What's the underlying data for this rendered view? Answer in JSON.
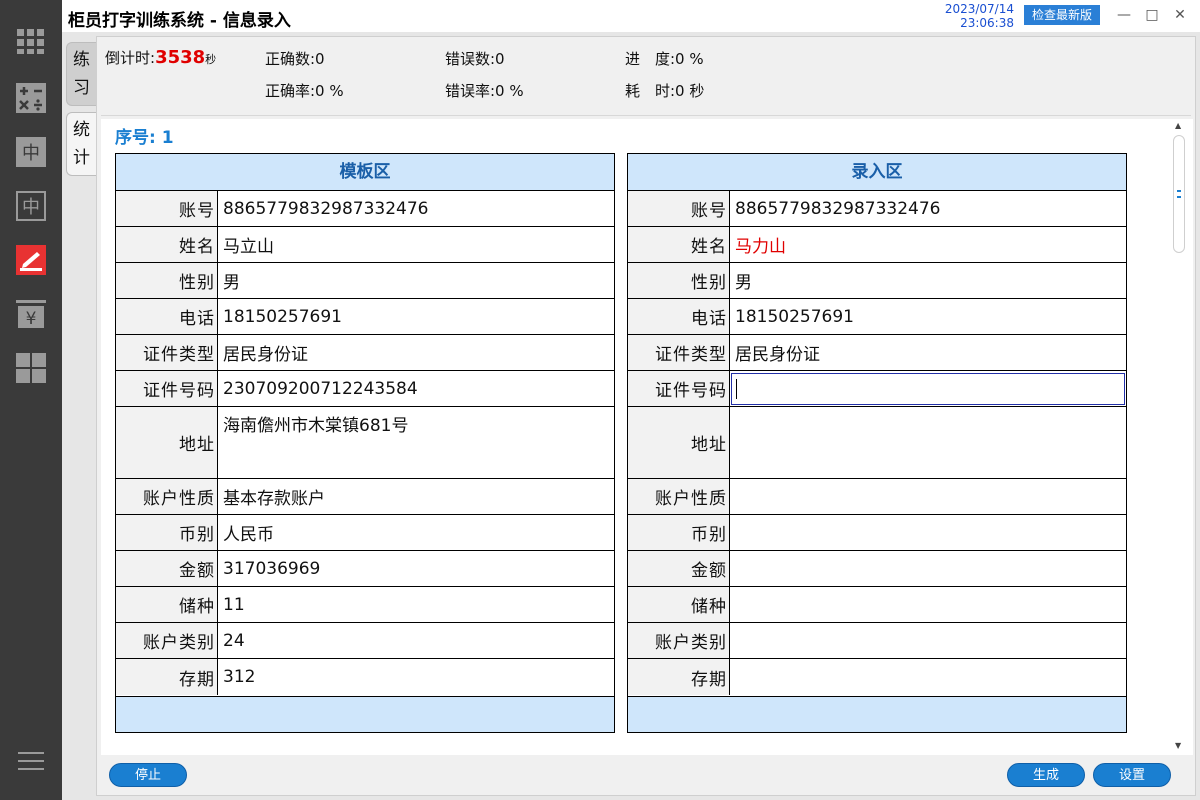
{
  "window": {
    "title": "柜员打字训练系统 - 信息录入",
    "date": "2023/07/14",
    "time": "23:06:38",
    "update_button": "检查最新版",
    "minimize": "—",
    "maximize": "□",
    "close": "✕"
  },
  "tabs": [
    {
      "label": "练习"
    },
    {
      "label": "统计"
    }
  ],
  "stats": {
    "countdown_label": "倒计时:",
    "countdown_value": "3538",
    "countdown_unit": "秒",
    "correct_count": "正确数:0",
    "error_count": "错误数:0",
    "progress": "进　度:0 %",
    "correct_rate": "正确率:0 %",
    "error_rate": "错误率:0 %",
    "elapsed": "耗　时:0 秒"
  },
  "sequence": "序号: 1",
  "template": {
    "header": "模板区",
    "rows": [
      {
        "label": "账号",
        "value": "8865779832987332476"
      },
      {
        "label": "姓名",
        "value": "马立山"
      },
      {
        "label": "性别",
        "value": "男"
      },
      {
        "label": "电话",
        "value": "18150257691"
      },
      {
        "label": "证件类型",
        "value": "居民身份证"
      },
      {
        "label": "证件号码",
        "value": "230709200712243584"
      },
      {
        "label": "地址",
        "value": "海南儋州市木棠镇681号"
      },
      {
        "label": "账户性质",
        "value": "基本存款账户"
      },
      {
        "label": "币别",
        "value": "人民币"
      },
      {
        "label": "金额",
        "value": "317036969"
      },
      {
        "label": "储种",
        "value": "11"
      },
      {
        "label": "账户类别",
        "value": "24"
      },
      {
        "label": "存期",
        "value": "312"
      }
    ]
  },
  "entry": {
    "header": "录入区",
    "rows": [
      {
        "label": "账号",
        "value": "8865779832987332476"
      },
      {
        "label": "姓名",
        "value": "马力山"
      },
      {
        "label": "性别",
        "value": "男"
      },
      {
        "label": "电话",
        "value": "18150257691"
      },
      {
        "label": "证件类型",
        "value": "居民身份证"
      },
      {
        "label": "证件号码",
        "value": ""
      },
      {
        "label": "地址",
        "value": ""
      },
      {
        "label": "账户性质",
        "value": ""
      },
      {
        "label": "币别",
        "value": ""
      },
      {
        "label": "金额",
        "value": ""
      },
      {
        "label": "储种",
        "value": ""
      },
      {
        "label": "账户类别",
        "value": ""
      },
      {
        "label": "存期",
        "value": ""
      }
    ]
  },
  "buttons": {
    "stop": "停止",
    "generate": "生成",
    "settings": "设置"
  },
  "colors": {
    "sidebar": "#3a3a3a",
    "accent": "#1a7fd1",
    "error": "#e00000",
    "table_header": "#cfe6fb"
  },
  "icons": [
    "grid-apps-icon",
    "calculator-icon",
    "chinese-char-icon",
    "chinese-char-outline-icon",
    "signature-icon",
    "yuan-icon",
    "dashboard-icon",
    "menu-icon"
  ]
}
